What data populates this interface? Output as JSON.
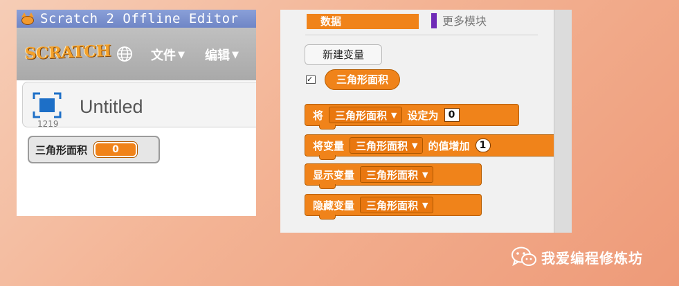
{
  "window": {
    "title": "Scratch 2 Offline Editor"
  },
  "menubar": {
    "logo_text": "SCRATCH",
    "file_label": "文件",
    "edit_label": "编辑"
  },
  "project": {
    "title": "Untitled",
    "version": "1219"
  },
  "stage_monitor": {
    "label": "三角形面积",
    "value": "0"
  },
  "palette": {
    "category_data": "数据",
    "category_more": "更多模块",
    "new_variable_button": "新建变量",
    "variable_checked": true,
    "variable_name": "三角形面积"
  },
  "blocks": {
    "set": {
      "prefix": "将",
      "variable": "三角形面积",
      "middle": "设定为",
      "value": "0"
    },
    "change": {
      "prefix": "将变量",
      "variable": "三角形面积",
      "middle": "的值增加",
      "value": "1"
    },
    "show": {
      "prefix": "显示变量",
      "variable": "三角形面积"
    },
    "hide": {
      "prefix": "隐藏变量",
      "variable": "三角形面积"
    }
  },
  "watermark": {
    "text": "我爱编程修炼坊"
  },
  "colors": {
    "data_orange": "#f0831a",
    "more_blocks_purple": "#6f2bb7",
    "titlebar_blue": "#7b92cf"
  }
}
